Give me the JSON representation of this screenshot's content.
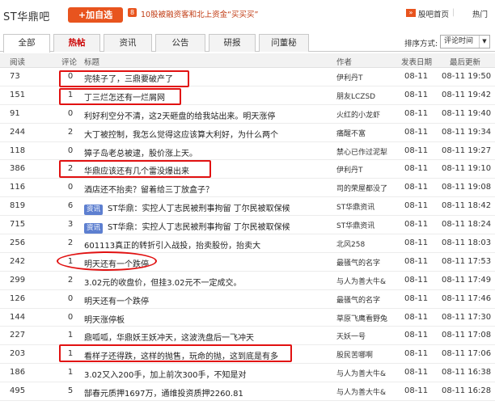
{
  "header": {
    "bar_title": "ST华鼎吧",
    "add_button": "+加自选",
    "news_icon": "8",
    "news_text": "10股被融资客和北上资金“买买买”",
    "home_arrow": "»",
    "home_link": "股吧首页",
    "separator": "|",
    "hot_link": "热门"
  },
  "tabs": [
    {
      "label": "全部"
    },
    {
      "label": "热帖"
    },
    {
      "label": "资讯"
    },
    {
      "label": "公告"
    },
    {
      "label": "研报"
    },
    {
      "label": "问董秘"
    }
  ],
  "sort": {
    "label": "排序方式:",
    "value": "评论时间",
    "caret": "▼"
  },
  "columns": {
    "read": "阅读",
    "comments": "评论",
    "title": "标题",
    "author": "作者",
    "post_time": "发表日期",
    "last_update": "最后更新"
  },
  "rows": [
    {
      "read": "73",
      "comments": "0",
      "tag": "",
      "title": "完犊子了，三鼎要破产了",
      "author": "伊利丹T",
      "date": "08-11",
      "time": "08-11 19:50"
    },
    {
      "read": "151",
      "comments": "1",
      "tag": "",
      "title": "丁三烂怎还有一烂屑网",
      "author": "朋友LCZSD",
      "date": "08-11",
      "time": "08-11 19:42"
    },
    {
      "read": "91",
      "comments": "0",
      "tag": "",
      "title": "利好利空分不清，这2天砸盘的给我站出来。明天涨停",
      "author": "火红的小龙虾",
      "date": "08-11",
      "time": "08-11 19:40"
    },
    {
      "read": "244",
      "comments": "2",
      "tag": "",
      "title": "大丁被控制，我怎么觉得这应该算大利好，为什么两个",
      "author": "痛醒不富",
      "date": "08-11",
      "time": "08-11 19:34"
    },
    {
      "read": "118",
      "comments": "0",
      "tag": "",
      "title": "獐子岛老总被逮，股价涨上天。",
      "author": "禁心已作过泥犁",
      "date": "08-11",
      "time": "08-11 19:27"
    },
    {
      "read": "386",
      "comments": "2",
      "tag": "",
      "title": "华鼎应该还有几个雷没爆出来",
      "author": "伊利丹T",
      "date": "08-11",
      "time": "08-11 19:10"
    },
    {
      "read": "116",
      "comments": "0",
      "tag": "",
      "title": "酒店还不抬卖？留着给三丁放盒子？",
      "author": "司的荣屋都没了",
      "date": "08-11",
      "time": "08-11 19:08"
    },
    {
      "read": "819",
      "comments": "6",
      "tag": "资讯",
      "title": "ST华鼎：实控人丁志民被刑事拘留 丁尔民被取保候",
      "author": "ST华鼎资讯",
      "date": "08-11",
      "time": "08-11 18:42"
    },
    {
      "read": "715",
      "comments": "3",
      "tag": "资讯",
      "title": "ST华鼎：实控人丁志民被刑事拘留 丁尔民被取保候",
      "author": "ST华鼎资讯",
      "date": "08-11",
      "time": "08-11 18:24"
    },
    {
      "read": "256",
      "comments": "2",
      "tag": "",
      "title": "601113真正的转折引入战投，抬卖股份，抬卖大",
      "author": "北风258",
      "date": "08-11",
      "time": "08-11 18:03"
    },
    {
      "read": "242",
      "comments": "1",
      "tag": "",
      "title": "明天还有一个跌停",
      "author": "最骚气的名字",
      "date": "08-11",
      "time": "08-11 17:53"
    },
    {
      "read": "299",
      "comments": "2",
      "tag": "",
      "title": "3.02元的收盘价，但挂3.02元不一定成交。",
      "author": "与人为善大牛&",
      "date": "08-11",
      "time": "08-11 17:49"
    },
    {
      "read": "126",
      "comments": "0",
      "tag": "",
      "title": "明天还有一个跌停",
      "author": "最骚气的名字",
      "date": "08-11",
      "time": "08-11 17:46"
    },
    {
      "read": "144",
      "comments": "0",
      "tag": "",
      "title": "明天涨停板",
      "author": "草原飞鹰看野兔",
      "date": "08-11",
      "time": "08-11 17:30"
    },
    {
      "read": "227",
      "comments": "1",
      "tag": "",
      "title": "鼎呱呱，华鼎妖王妖冲天，这波洗盘后一飞冲天",
      "author": "天妖一号",
      "date": "08-11",
      "time": "08-11 17:08"
    },
    {
      "read": "203",
      "comments": "1",
      "tag": "",
      "title": "看样子还得跌，这样的抛售，玩命的抛，这到底是有多",
      "author": "股民苦哪啊",
      "date": "08-11",
      "time": "08-11 17:06"
    },
    {
      "read": "186",
      "comments": "1",
      "tag": "",
      "title": "3.02又入200手，加上前次300手，不知是对",
      "author": "与人为善大牛&",
      "date": "08-11",
      "time": "08-11 16:38"
    },
    {
      "read": "495",
      "comments": "5",
      "tag": "",
      "title": "郜春元质押1697万，通维投资质押2260.81",
      "author": "与人为善大牛&",
      "date": "08-11",
      "time": "08-11 16:28"
    }
  ],
  "highlight_color": "#e11111"
}
